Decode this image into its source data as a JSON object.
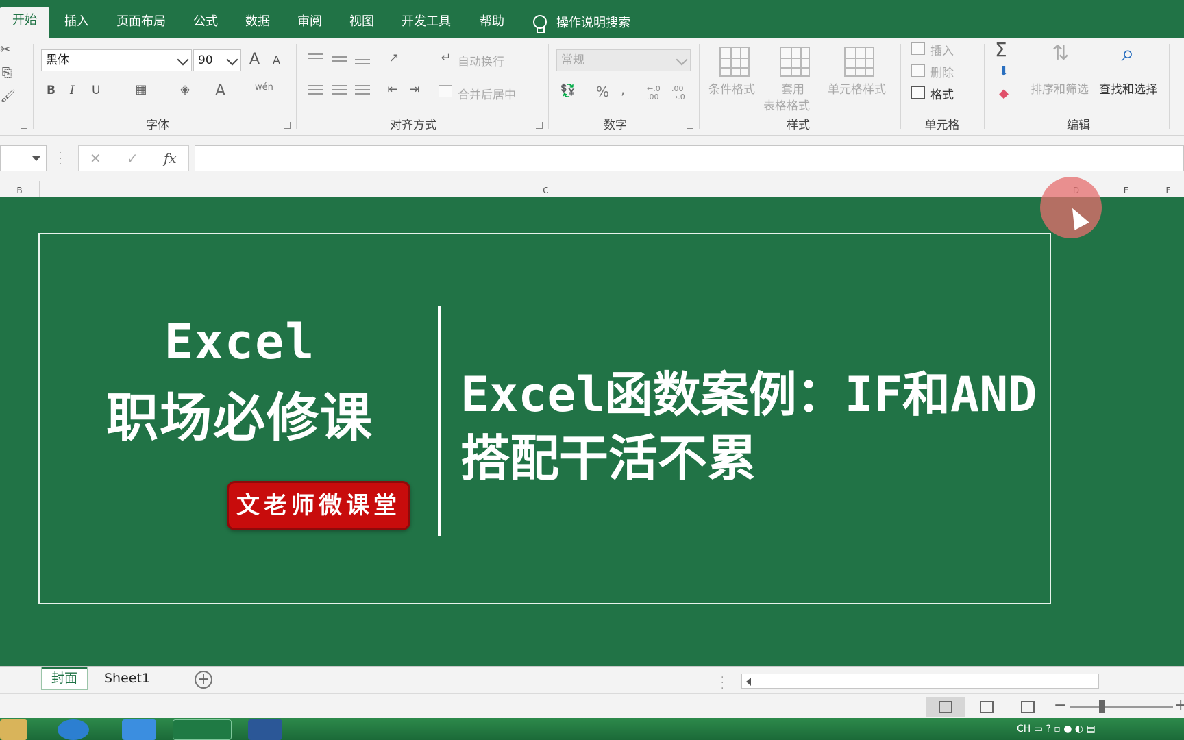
{
  "tabs": [
    {
      "label": "开始",
      "active": true
    },
    {
      "label": "插入"
    },
    {
      "label": "页面布局"
    },
    {
      "label": "公式"
    },
    {
      "label": "数据"
    },
    {
      "label": "审阅"
    },
    {
      "label": "视图"
    },
    {
      "label": "开发工具"
    },
    {
      "label": "帮助"
    }
  ],
  "tell_me": "操作说明搜索",
  "ribbon": {
    "font": {
      "label": "字体",
      "name": "黑体",
      "size": "90",
      "bold": "B",
      "italic": "I",
      "underline": "U",
      "grow": "A",
      "shrink": "A",
      "phonetic": "wén",
      "font_color": "A"
    },
    "alignment": {
      "label": "对齐方式",
      "wrap_text": "自动换行",
      "merge_center": "合并后居中"
    },
    "number": {
      "label": "数字",
      "format": "常规",
      "percent": "%",
      "comma": ",",
      "inc_decimal": "←.0 .00",
      "dec_decimal": ".00 →.0"
    },
    "styles": {
      "label": "样式",
      "conditional": "条件格式",
      "table_1": "套用",
      "table_2": "表格格式",
      "cell_styles": "单元格样式"
    },
    "cells": {
      "label": "单元格",
      "insert": "插入",
      "delete": "删除",
      "format": "格式"
    },
    "editing": {
      "label": "编辑",
      "sort_filter": "排序和筛选",
      "find_select": "查找和选择",
      "sigma": "Σ"
    }
  },
  "formula": {
    "name_box": "",
    "cancel": "✕",
    "enter": "✓",
    "fx": "fx",
    "value": ""
  },
  "columns": [
    "B",
    "C",
    "D",
    "E",
    "F"
  ],
  "cover": {
    "left_line1": "Excel",
    "left_line2": "职场必修课",
    "badge": "文老师微课堂",
    "right_line1": "Excel函数案例：IF和AND",
    "right_line2": "搭配干活不累"
  },
  "sheets": [
    {
      "label": "封面",
      "active": true
    },
    {
      "label": "Sheet1"
    }
  ],
  "add_sheet": "+",
  "status": {
    "zoom_minus": "−",
    "zoom_plus": "+"
  },
  "colors": {
    "excel_green": "#217346",
    "badge_red": "#c80c0c"
  }
}
